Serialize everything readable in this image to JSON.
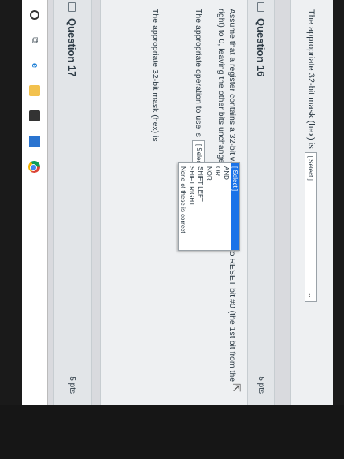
{
  "prev_question": {
    "text": "The appropriate 32-bit mask (hex) is",
    "select_value": "[ Select ]"
  },
  "question16": {
    "title": "Question 16",
    "points": "5 pts",
    "prompt": "Assume that a register contains a 32-bit value, in which you want to RESET bit #0 (the 1st bit from the right) to 0, leaving the other bits unchanged.",
    "op_label": "The appropriate operation to use is",
    "op_select_value": "[ Select ]",
    "mask_label": "The appropriate 32-bit mask (hex) is",
    "dropdown_options": [
      "[ Select ]",
      "AND",
      "OR",
      "NOR",
      "SHIFT LEFT",
      "SHIFT RIGHT",
      "None of these is correct"
    ],
    "highlighted_option": "[ Select ]"
  },
  "question17": {
    "title": "Question 17",
    "points": "5 pts"
  },
  "taskbar": {
    "icons": [
      "search-icon",
      "task-view-icon",
      "edge-icon",
      "file-explorer-icon",
      "store-icon",
      "mail-icon",
      "chrome-icon"
    ]
  }
}
